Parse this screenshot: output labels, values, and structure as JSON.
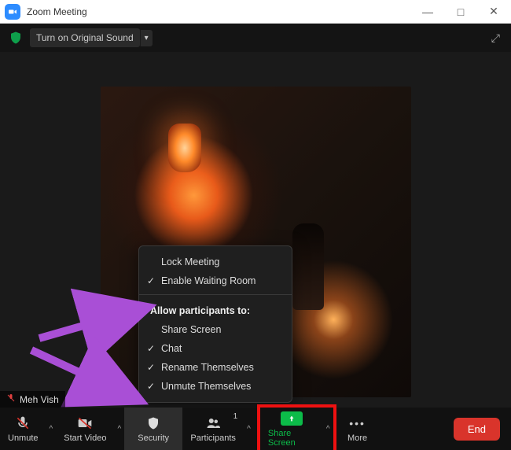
{
  "window": {
    "title": "Zoom Meeting"
  },
  "subbar": {
    "sound_label": "Turn on Original Sound"
  },
  "participant_name": "Meh Vish",
  "security_menu": {
    "lock": "Lock Meeting",
    "waiting": "Enable Waiting Room",
    "allow_header": "Allow participants to:",
    "share": "Share Screen",
    "chat": "Chat",
    "rename": "Rename Themselves",
    "unmute": "Unmute Themselves"
  },
  "toolbar": {
    "unmute": "Unmute",
    "start_video": "Start Video",
    "security": "Security",
    "participants": "Participants",
    "participants_count": "1",
    "share_screen": "Share Screen",
    "more": "More",
    "end": "End"
  }
}
